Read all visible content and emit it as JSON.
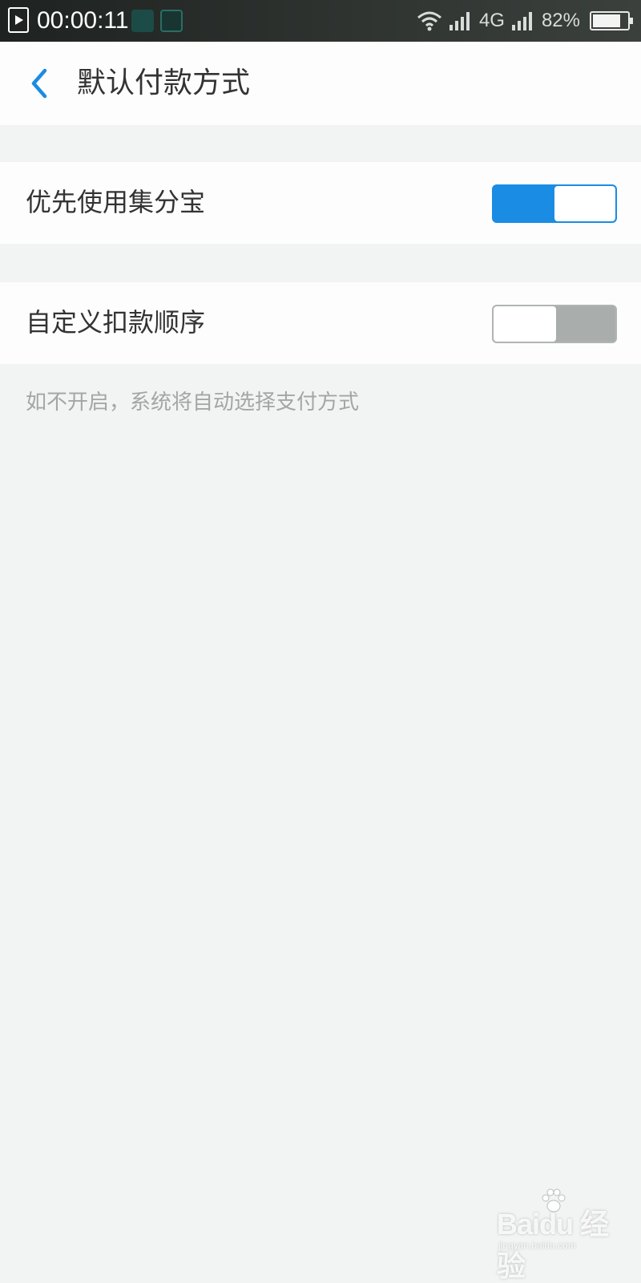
{
  "status_bar": {
    "recording_time": "00:00:11",
    "network": "4G",
    "battery_percent": "82%",
    "battery_level": 0.82
  },
  "header": {
    "title": "默认付款方式"
  },
  "settings": [
    {
      "label": "优先使用集分宝",
      "enabled": true
    },
    {
      "label": "自定义扣款顺序",
      "enabled": false
    }
  ],
  "hint": "如不开启，系统将自动选择支付方式",
  "watermark": {
    "brand": "Baidu 经验",
    "url": "jingyan.baidu.com"
  },
  "colors": {
    "accent": "#1a8ce4",
    "background": "#f1f4f2",
    "toggle_off": "#a9aeac"
  }
}
